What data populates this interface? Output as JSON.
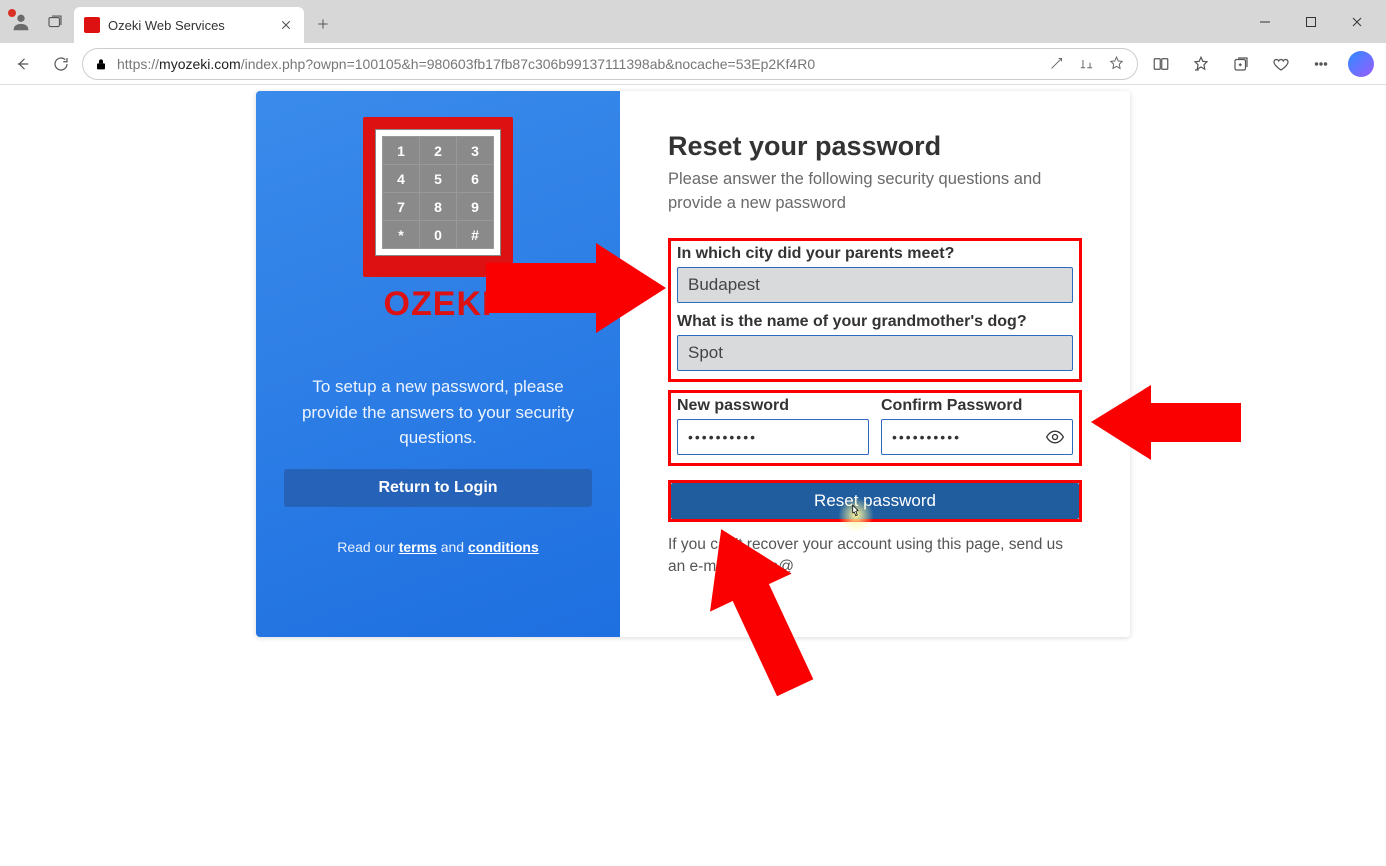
{
  "browser": {
    "tab_title": "Ozeki Web Services",
    "url_host": "myozeki.com",
    "url_prefix": "https://",
    "url_path": "/index.php?owpn=100105&h=980603fb17fb87c306b99137111398ab&nocache=53Ep2Kf4R0"
  },
  "left": {
    "brand": "OZEKI",
    "desc": "To setup a new password, please provide the answers to your security questions.",
    "return_btn": "Return to Login",
    "footer_pre": "Read our ",
    "footer_terms": "terms",
    "footer_and": " and ",
    "footer_cond": "conditions"
  },
  "right": {
    "title": "Reset your password",
    "sub": "Please answer the following security questions and provide a new password",
    "q1_label": "In which city did your parents meet?",
    "q1_value": "Budapest",
    "q2_label": "What is the name of your grandmother's dog?",
    "q2_value": "Spot",
    "newpw_label": "New password",
    "confpw_label": "Confirm Password",
    "newpw_value": "••••••••••",
    "confpw_value": "••••••••••",
    "reset_btn": "Reset password",
    "help": "If you can't recover your account using this page, send us an e-mail to info@"
  },
  "keypad": [
    [
      "1",
      "2",
      "3"
    ],
    [
      "4",
      "5",
      "6"
    ],
    [
      "7",
      "8",
      "9"
    ],
    [
      "*",
      "0",
      "#"
    ]
  ]
}
